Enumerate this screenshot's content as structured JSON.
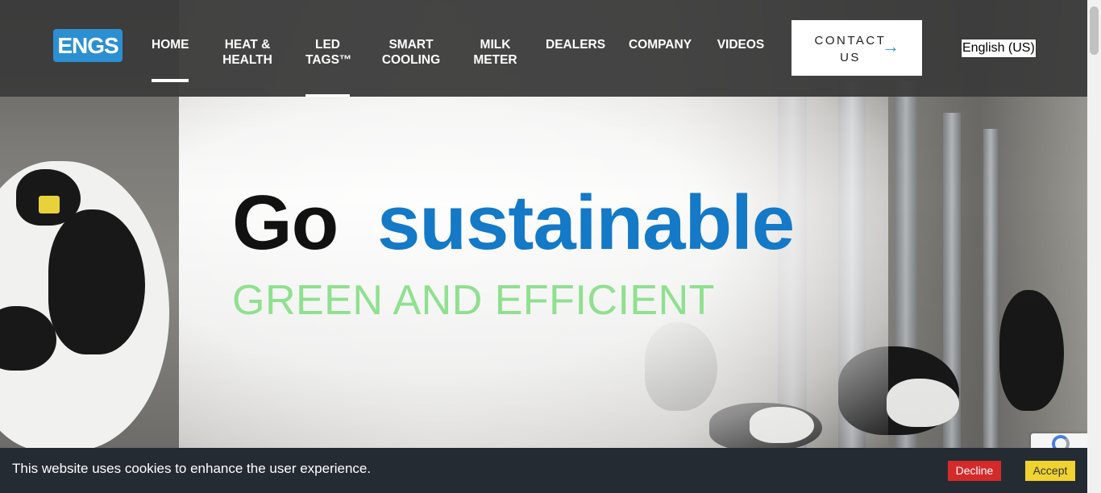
{
  "header": {
    "logo_text": "ENGS",
    "nav": [
      {
        "label": "HOME",
        "line2": ""
      },
      {
        "label": "HEAT &",
        "line2": "HEALTH"
      },
      {
        "label": "LED",
        "line2": "TAGS™"
      },
      {
        "label": "SMART",
        "line2": "COOLING"
      },
      {
        "label": "MILK",
        "line2": "METER"
      },
      {
        "label": "DEALERS",
        "line2": ""
      },
      {
        "label": "COMPANY",
        "line2": ""
      },
      {
        "label": "VIDEOS",
        "line2": ""
      }
    ],
    "contact": {
      "line1": "CONTACT",
      "line2": "US",
      "arrow": "→"
    },
    "language": "English (US)"
  },
  "hero": {
    "headline_1": "Go",
    "headline_2": "sustainable",
    "subheadline": "GREEN AND EFFICIENT"
  },
  "cookie_bar": {
    "message": "This website uses cookies to enhance the user experience.",
    "decline_label": "Decline",
    "accept_label": "Accept"
  },
  "colors": {
    "brand_blue": "#1479c6",
    "green_text": "#8fe08f",
    "decline_red": "#d42a2a",
    "accept_yellow": "#f0d230",
    "header_bg": "#3a3a3a",
    "cookie_bg": "#252b33"
  },
  "icons": {
    "contact_arrow": "arrow-right-icon",
    "recaptcha": "recaptcha-icon"
  }
}
